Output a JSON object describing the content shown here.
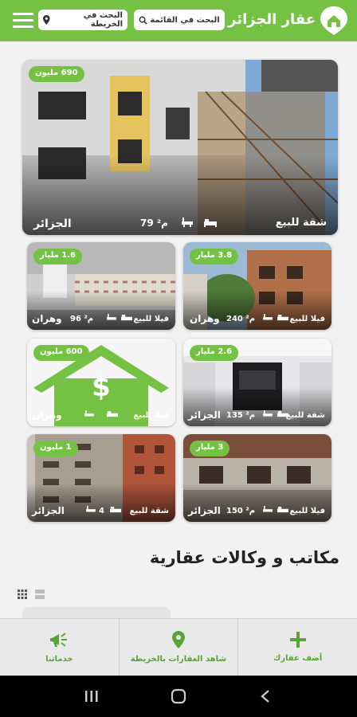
{
  "header": {
    "brand": "عقار الجزائر",
    "search_list_label": "البحث في القائمة",
    "search_map_label": "البحث في الخريطة"
  },
  "listings": [
    {
      "price": "690 مليون",
      "type": "شقة للبيع",
      "area": "79 م²",
      "city": "الجزائر"
    },
    {
      "price": "3.8 مليار",
      "type": "فيلا للبيع",
      "area": "240 م²",
      "city": "وهران"
    },
    {
      "price": "1.6 مليار",
      "type": "فيلا للبيع",
      "area": "96 م²",
      "city": "وهران"
    },
    {
      "price": "2.6 مليار",
      "type": "شقة للبيع",
      "area": "135 م²",
      "city": "الجزائر"
    },
    {
      "price": "600 مليون",
      "type": "فيلا للبيع",
      "area": "",
      "city": "وهران"
    },
    {
      "price": "3 مليار",
      "type": "فيلا للبيع",
      "area": "150 م²",
      "city": "الجزائر"
    },
    {
      "price": "1 مليون",
      "type": "شقة للبيع",
      "area": "4",
      "city": "الجزائر"
    }
  ],
  "agencies": {
    "title": "مكاتب و وكالات عقارية"
  },
  "bottom_nav": {
    "add_label": "أضف عقارك",
    "map_label": "شاهد العقارات بالخريطة",
    "services_label": "خدماتنا"
  },
  "colors": {
    "brand_green": "#74c143"
  }
}
